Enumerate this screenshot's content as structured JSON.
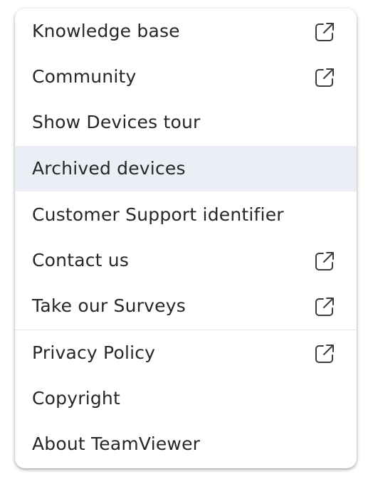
{
  "menu": {
    "items": [
      {
        "label": "Knowledge base",
        "external": true
      },
      {
        "label": "Community",
        "external": true
      },
      {
        "label": "Show Devices tour",
        "external": false
      },
      {
        "label": "Archived devices",
        "external": false,
        "highlighted": true
      },
      {
        "label": "Customer Support identifier",
        "external": false
      },
      {
        "label": "Contact us",
        "external": true
      },
      {
        "label": "Take our Surveys",
        "external": true
      },
      {
        "label": "Privacy Policy",
        "external": true
      },
      {
        "label": "Copyright",
        "external": false
      },
      {
        "label": "About TeamViewer",
        "external": false
      }
    ],
    "icon": "external-link-icon",
    "colors": {
      "text": "#25272b",
      "highlight_background": "#eceef5",
      "icon_stroke": "#3b3d42",
      "divider": "#e6e7ea"
    }
  }
}
